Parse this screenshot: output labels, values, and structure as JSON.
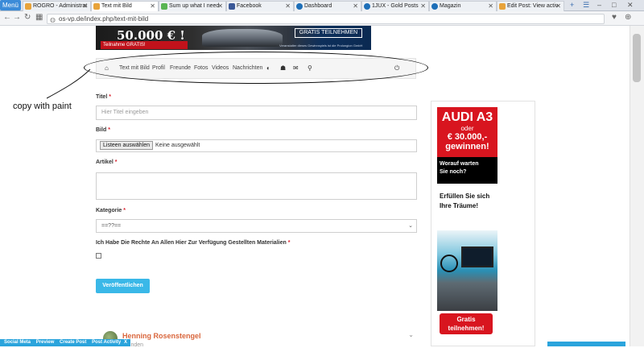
{
  "browser": {
    "menu_label": "Menü",
    "tabs": [
      {
        "label": "ROGRO - Administrat",
        "color": "#e8a33a",
        "active": false
      },
      {
        "label": "Text mit Bild",
        "color": "#e8a33a",
        "active": true
      },
      {
        "label": "Sum up what I need",
        "color": "#5ab552",
        "active": false
      },
      {
        "label": "Facebook",
        "color": "#3b5998",
        "active": false
      },
      {
        "label": "Dashboard",
        "color": "#1e6fb8",
        "active": false
      },
      {
        "label": "1JUX - Gold Posts",
        "color": "#1e6fb8",
        "active": false
      },
      {
        "label": "Magazin",
        "color": "#1e6fb8",
        "active": false
      },
      {
        "label": "Edit Post: View activ",
        "color": "#e8a33a",
        "active": false
      }
    ],
    "tab_close": "✕",
    "new_tab": "+",
    "url": "os-vp.de/index.php/text-mit-bild"
  },
  "banner": {
    "amount": "50.000 € !",
    "sub": "Teilnahme GRATIS!",
    "join": "GRATIS TEILNEHMEN",
    "fine": "Veranstalter dieses Gewinnspiels ist die Prolongion GmbH"
  },
  "subnav": {
    "items": [
      "Text mit Bild",
      "Profil",
      "Freunde",
      "Fotos",
      "Videos",
      "Nachrichten"
    ]
  },
  "annotation": {
    "text": "copy with paint"
  },
  "form": {
    "title_label": "Titel",
    "title_placeholder": "Hier Titel eingeben",
    "image_label": "Bild",
    "file_button": "Listeen auswählen",
    "file_status": "Keine ausgewählt",
    "article_label": "Artikel",
    "category_label": "Kategorie",
    "category_value": "==??==",
    "rights_label": "Ich Habe Die Rechte An Allen Hier Zur Verfügung Gestellten Materialien",
    "submit_label": "Veröffentlichen",
    "required_mark": "*"
  },
  "sidebar_ad": {
    "brand": "AUDI A3",
    "or": "oder",
    "amount": "€ 30.000,-",
    "win": "gewinnen!",
    "question_1": "Worauf warten",
    "question_2": "Sie noch?",
    "dream_1": "Erfüllen Sie sich",
    "dream_2": "Ihre Träume!",
    "gratis_1": "Gratis",
    "gratis_2": "teilnehmen!"
  },
  "comment": {
    "name": "Henning Rosenstengel",
    "time": "Stunden"
  },
  "adminbar": {
    "items": [
      "Social Meta",
      "Preview",
      "Create Post",
      "Post Activity"
    ],
    "close": "X"
  }
}
